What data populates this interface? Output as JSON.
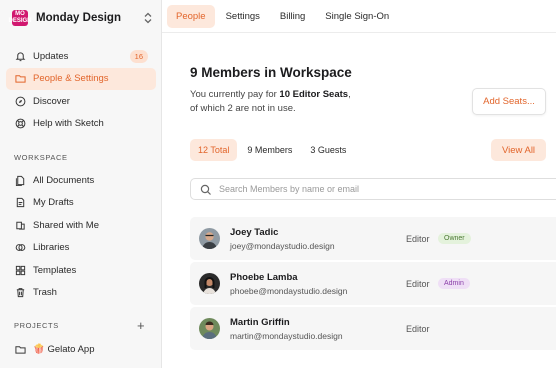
{
  "workspace": {
    "name": "Monday Design",
    "logo_text": "MO\nDESIGN",
    "logo_color": "#d1176f"
  },
  "sidebar": {
    "primary": [
      {
        "label": "Updates",
        "icon": "bell-icon",
        "badge": "16"
      },
      {
        "label": "People & Settings",
        "icon": "folder-icon",
        "active": true
      },
      {
        "label": "Discover",
        "icon": "compass-icon"
      },
      {
        "label": "Help with Sketch",
        "icon": "lifebuoy-icon"
      }
    ],
    "workspace_label": "WORKSPACE",
    "workspace_items": [
      {
        "label": "All Documents",
        "icon": "documents-icon"
      },
      {
        "label": "My Drafts",
        "icon": "drafts-icon"
      },
      {
        "label": "Shared with Me",
        "icon": "shared-icon"
      },
      {
        "label": "Libraries",
        "icon": "libraries-icon"
      },
      {
        "label": "Templates",
        "icon": "templates-icon"
      },
      {
        "label": "Trash",
        "icon": "trash-icon"
      }
    ],
    "projects_label": "PROJECTS",
    "projects": [
      {
        "label": "🍿 Gelato App",
        "icon": "folder-icon"
      }
    ]
  },
  "tabs": [
    "People",
    "Settings",
    "Billing",
    "Single Sign-On"
  ],
  "main": {
    "title": "9 Members in Workspace",
    "subtitle_pre": "You currently pay for ",
    "subtitle_bold": "10 Editor Seats",
    "subtitle_post": ",",
    "subtitle_line2": "of which 2 are not in use.",
    "add_seats_label": "Add Seats...",
    "filters": [
      "12 Total",
      "9 Members",
      "3 Guests"
    ],
    "view_all_label": "View  All",
    "search_placeholder": "Search Members by name or email",
    "members": [
      {
        "name": "Joey Tadic",
        "email": "joey@mondaystudio.design",
        "role": "Editor",
        "tag": "Owner",
        "tag_bg": "#e4f2dc",
        "tag_color": "#4c7a34"
      },
      {
        "name": "Phoebe Lamba",
        "email": "phoebe@mondaystudio.design",
        "role": "Editor",
        "tag": "Admin",
        "tag_bg": "#efdff6",
        "tag_color": "#8a3ea8"
      },
      {
        "name": "Martin Griffin",
        "email": "martin@mondaystudio.design",
        "role": "Editor",
        "tag": ""
      }
    ]
  },
  "colors": {
    "accent": "#e2652b",
    "accent_bg": "#fde8dc"
  }
}
